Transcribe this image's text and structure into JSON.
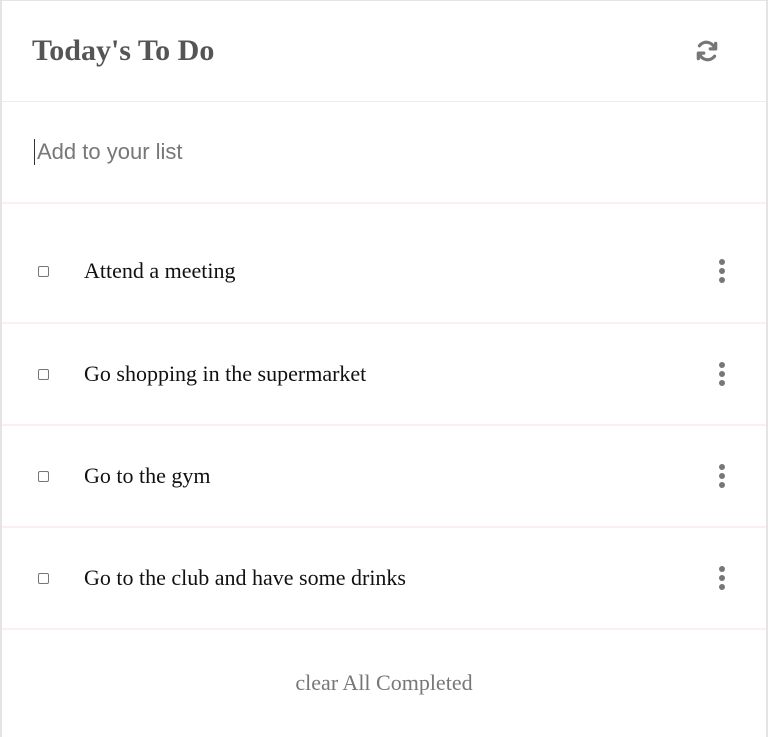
{
  "header": {
    "title": "Today's To Do",
    "refresh_icon": "refresh-icon"
  },
  "add_item": {
    "placeholder": "Add to your list",
    "value": ""
  },
  "items": [
    {
      "label": "Attend a meeting",
      "checked": false,
      "menu_icon": "more-vertical-icon"
    },
    {
      "label": "Go shopping in the supermarket",
      "checked": false,
      "menu_icon": "more-vertical-icon"
    },
    {
      "label": "Go to the gym",
      "checked": false,
      "menu_icon": "more-vertical-icon"
    },
    {
      "label": "Go to the club and have some drinks",
      "checked": false,
      "menu_icon": "more-vertical-icon"
    }
  ],
  "footer": {
    "clear_label": "clear All Completed"
  },
  "colors": {
    "title": "#555555",
    "icon": "#777777",
    "divider": "#fbf0f0",
    "muted_text": "#777777"
  }
}
